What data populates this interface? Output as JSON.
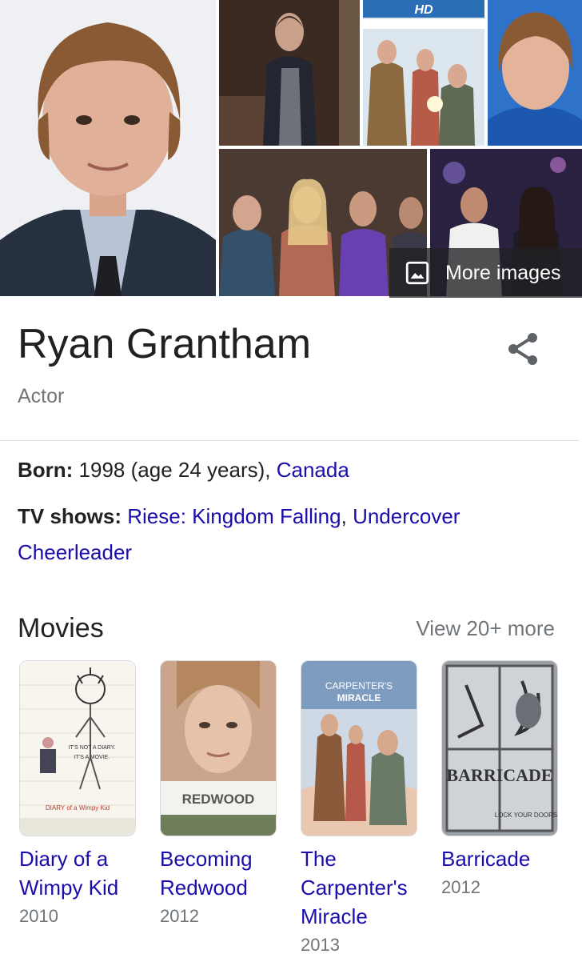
{
  "mosaic": {
    "more_images_label": "More images",
    "hd_badge": "HD",
    "tile_caption_redwood": "REDWOOD"
  },
  "person": {
    "name": "Ryan Grantham",
    "role": "Actor"
  },
  "facts": {
    "born_label": "Born:",
    "born_value": " 1998 (age 24 years), ",
    "born_link": "Canada",
    "tv_label": "TV shows:",
    "tv_link_1": "Riese: Kingdom Falling",
    "tv_sep": ", ",
    "tv_link_2": "Undercover Cheerleader"
  },
  "movies": {
    "heading": "Movies",
    "view_more": "View 20+ more",
    "items": [
      {
        "title": "Diary of a Wimpy Kid",
        "year": "2010",
        "poster_text_1": "IT'S NOT A DIARY.",
        "poster_text_2": "IT'S A MOVIE.",
        "poster_logo": "DIARY of a Wimpy Kid"
      },
      {
        "title": "Becoming Redwood",
        "year": "2012",
        "poster_text_1": "REDWOOD"
      },
      {
        "title": "The Carpenter's Miracle",
        "year": "2013",
        "poster_text_1": "CARPENTER'S",
        "poster_text_2": "MIRACLE"
      },
      {
        "title": "Barricade",
        "year": "2012",
        "poster_text_1": "BARRICADE",
        "poster_text_2": "LOCK YOUR DOORS"
      }
    ]
  },
  "colors": {
    "link": "#1a0dab",
    "secondary_text": "#70757a",
    "divider": "#dadce0"
  },
  "icons": [
    "image-icon",
    "share-icon"
  ]
}
